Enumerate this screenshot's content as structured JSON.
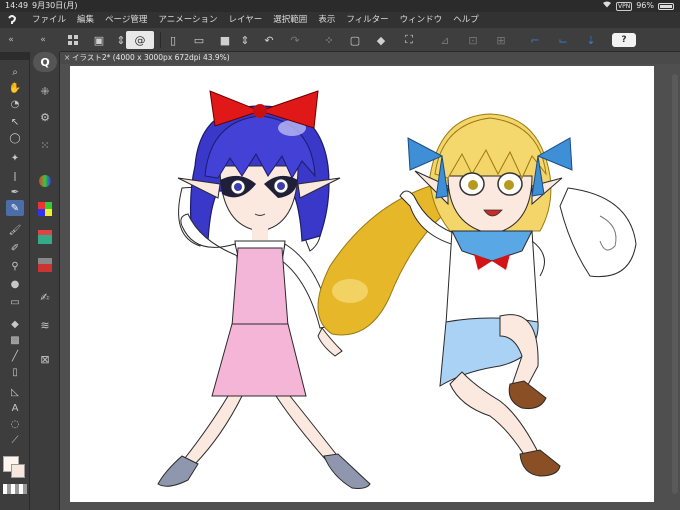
{
  "status": {
    "time": "14:49",
    "date": "9月30日(月)",
    "vpn": "VPN",
    "battery": "96%",
    "battery_level": 0.96
  },
  "menu": {
    "items": [
      "ファイル",
      "編集",
      "ページ管理",
      "アニメーション",
      "レイヤー",
      "選択範囲",
      "表示",
      "フィルター",
      "ウィンドウ",
      "ヘルプ"
    ]
  },
  "toolbar": {
    "help_label": "?"
  },
  "document": {
    "tab_title": "イラスト2* (4000 x 3000px 672dpi 43.9%)"
  },
  "colors": {
    "accent": "#4b6ea8",
    "panel": "#3d3d3d",
    "canvas": "#ffffff",
    "foreground_color": "#fff4ee",
    "background_color": "#f7e7df"
  },
  "icons": [
    "zoom-icon",
    "hand-icon",
    "rotate-icon",
    "select-icon",
    "move-icon",
    "eyedropper-icon",
    "pen-icon",
    "pencil-icon",
    "brush-icon",
    "airbrush-icon",
    "blend-icon",
    "eraser-icon",
    "fill-icon",
    "gradient-icon",
    "figure-icon",
    "frame-icon",
    "ruler-icon",
    "text-icon",
    "balloon-icon",
    "line-icon"
  ]
}
